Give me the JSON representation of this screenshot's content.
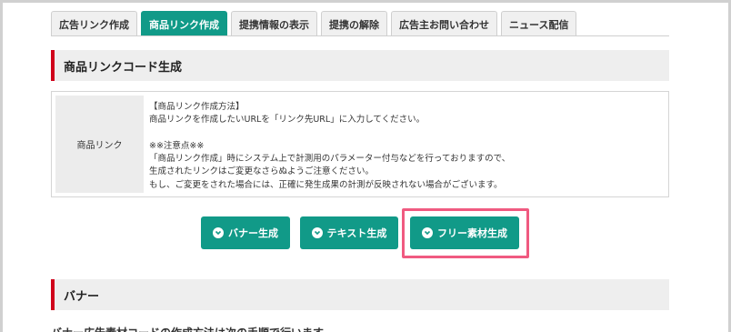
{
  "tabs": [
    {
      "label": "広告リンク作成",
      "active": false
    },
    {
      "label": "商品リンク作成",
      "active": true
    },
    {
      "label": "提携情報の表示",
      "active": false
    },
    {
      "label": "提携の解除",
      "active": false
    },
    {
      "label": "広告主お問い合わせ",
      "active": false
    },
    {
      "label": "ニュース配信",
      "active": false
    }
  ],
  "section_title": "商品リンクコード生成",
  "info": {
    "header": "商品リンク",
    "lines": [
      "【商品リンク作成方法】",
      "商品リンクを作成したいURLを「リンク先URL」に入力してください。",
      "",
      "※※注意点※※",
      "「商品リンク作成」時にシステム上で計測用のパラメーター付与などを行っておりますので、",
      "生成されたリンクはご変更なさらぬようご注意ください。",
      "もし、ご変更をされた場合には、正確に発生成果の計測が反映されない場合がございます。"
    ]
  },
  "buttons": {
    "banner": "バナー生成",
    "text": "テキスト生成",
    "free": "フリー素材生成"
  },
  "banner_section_title": "バナー",
  "cut_off_text": "バナー広告素材コードの作成方法は次の手順で行います。",
  "colors": {
    "accent": "#119a88",
    "section_bar": "#d0021b",
    "highlight": "#f05a80"
  },
  "icons": {
    "button_icon": "chevron-down-circle-icon"
  }
}
